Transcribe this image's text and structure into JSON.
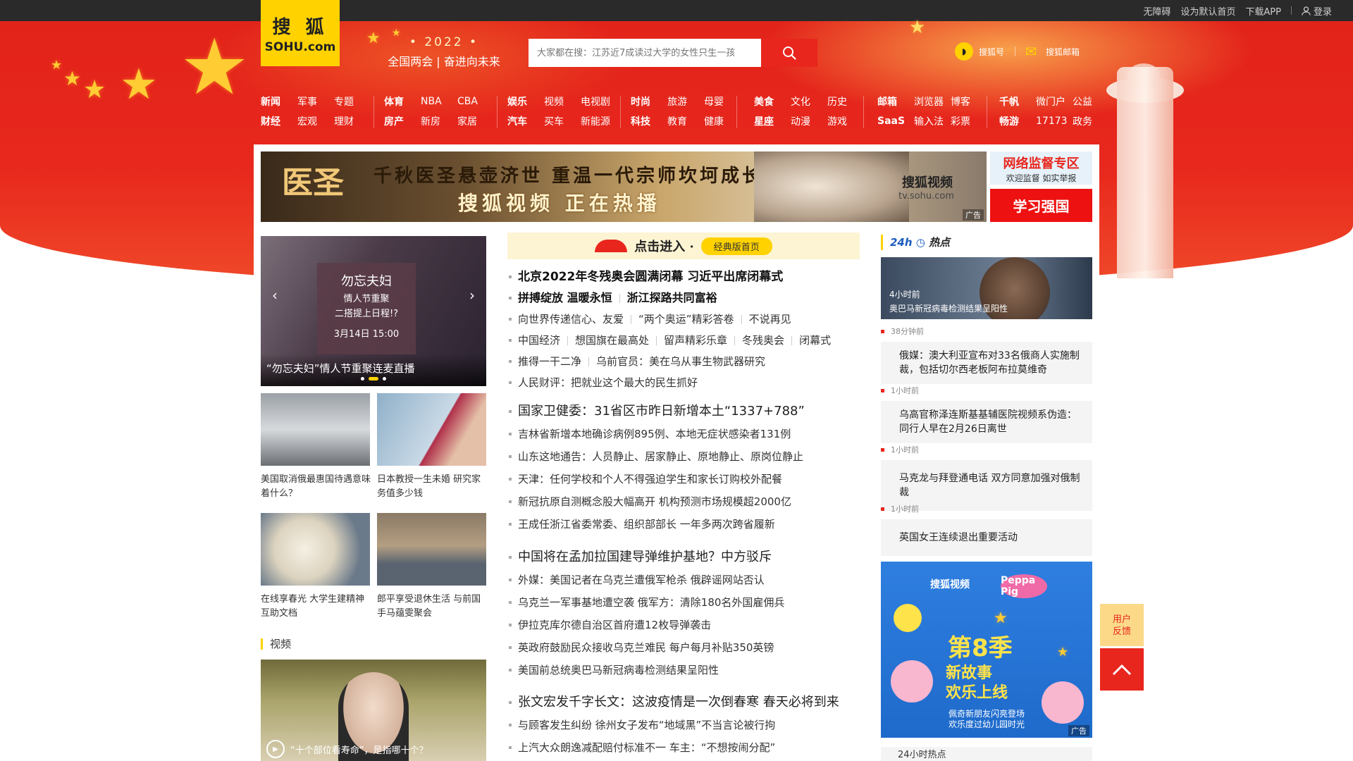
{
  "topbar": {
    "links": [
      "无障碍",
      "设为默认首页",
      "下载APP"
    ],
    "login": "登录"
  },
  "logo": {
    "text": "搜 狐",
    "sub": "SOHU.com"
  },
  "slogan": {
    "year": "• 2022 •",
    "line": "全国两会 | 奋进向未来"
  },
  "search": {
    "placeholder": "大家都在搜：江苏近7成读过大学的女性只生一孩"
  },
  "header_links": {
    "sohuhao": "搜狐号",
    "mail": "搜狐邮箱"
  },
  "nav": [
    {
      "row1": [
        "新闻",
        "军事",
        "专题"
      ],
      "row2": [
        "财经",
        "宏观",
        "理财"
      ]
    },
    {
      "row1": [
        "体育",
        "NBA",
        "CBA"
      ],
      "row2": [
        "房产",
        "新房",
        "家居"
      ]
    },
    {
      "row1": [
        "娱乐",
        "视频",
        "电视剧"
      ],
      "row2": [
        "汽车",
        "买车",
        "新能源"
      ]
    },
    {
      "row1": [
        "时尚",
        "旅游",
        "母婴"
      ],
      "row2": [
        "科技",
        "教育",
        "健康"
      ]
    },
    {
      "row1": [
        "美食",
        "文化",
        "历史"
      ],
      "row2": [
        "星座",
        "动漫",
        "游戏"
      ]
    },
    {
      "row1": [
        "邮箱",
        "浏览器",
        "博客"
      ],
      "row2": [
        "SaaS",
        "输入法",
        "彩票"
      ]
    },
    {
      "row1": [
        "千帆",
        "微门户",
        "公益"
      ],
      "row2": [
        "畅游",
        "17173",
        "政务"
      ]
    }
  ],
  "banner": {
    "seal": "医圣",
    "line1": "千秋医圣悬壶济世 重温一代宗师坎坷成长路",
    "line2": "搜狐视频 正在热播",
    "brand": "搜狐视频",
    "url": "tv.sohu.com",
    "ad": "广告"
  },
  "side_ads": {
    "title": "网络监督专区",
    "subtitle": "欢迎监督 如实举报",
    "xuexi": "学习强国"
  },
  "carousel": {
    "poster_title": "勿忘夫妇",
    "poster_sub1": "情人节重聚",
    "poster_sub2": "二搭提上日程!?",
    "poster_date": "3月14日 15:00",
    "caption": "“勿忘夫妇”情人节重聚连麦直播"
  },
  "thumbs": [
    {
      "caption": "美国取消俄最惠国待遇意味着什么？"
    },
    {
      "caption": "日本教授一生未婚 研究家务值多少钱"
    },
    {
      "caption": "在线享春光 大学生建精神互助文档"
    },
    {
      "caption": "郎平享受退休生活 与前国手马蕴雯聚会"
    }
  ],
  "video_section": {
    "title": "视频",
    "caption": "“十个部位看寿命”，是指哪十个？"
  },
  "classic": {
    "title": "点击进入 ·",
    "button": "经典版首页"
  },
  "news_group1": {
    "headline": "北京2022年冬残奥会圆满闭幕 习近平出席闭幕式",
    "sub": [
      "拼搏绽放 温暖永恒",
      "浙江探路共同富裕"
    ],
    "row3": [
      "向世界传递信心、友爱",
      "“两个奥运”精彩答卷",
      "不说再见"
    ],
    "row4": [
      "中国经济",
      "想国旗在最高处",
      "留声精彩乐章",
      "冬残奥会",
      "闭幕式"
    ],
    "row5": [
      "推得一干二净",
      "乌前官员：美在乌从事生物武器研究"
    ],
    "row6": "人民财评：把就业这个最大的民生抓好"
  },
  "news_group2": [
    "国家卫健委：31省区市昨日新增本土“1337+788”",
    "吉林省新增本地确诊病例895例、本地无症状感染者131例",
    "山东这地通告：人员静止、居家静止、原地静止、原岗位静止",
    "天津：任何学校和个人不得强迫学生和家长订购校外配餐",
    "新冠抗原自测概念股大幅高开 机构预测市场规模超2000亿",
    "王成任浙江省委常委、组织部部长 一年多两次跨省履新"
  ],
  "news_group3": [
    "中国将在孟加拉国建导弹维护基地？中方驳斥",
    "外媒：美国记者在乌克兰遭俄军枪杀 俄辟谣网站否认",
    "乌克兰一军事基地遭空袭 俄军方：清除180名外国雇佣兵",
    "伊拉克库尔德自治区首府遭12枚导弹袭击",
    "英政府鼓励民众接收乌克兰难民 每户每月补贴350英镑",
    "美国前总统奥巴马新冠病毒检测结果呈阳性"
  ],
  "news_group4": [
    "张文宏发千字长文：这波疫情是一次倒春寒 春天必将到来",
    "与顾客发生纠纷 徐州女子发布“地域黑”不当言论被行拘",
    "上汽大众朗逸减配赔付标准不一 车主：“不想按闹分配”"
  ],
  "hot": {
    "title_a": "24h",
    "title_b": "热点",
    "img_time": "4小时前",
    "img_caption": "奥巴马新冠病毒检测结果呈阳性",
    "items": [
      {
        "time": "38分钟前",
        "text": "俄媒：澳大利亚宣布对33名俄商人实施制裁，包括切尔西老板阿布拉莫维奇"
      },
      {
        "time": "1小时前",
        "text": "乌高官称泽连斯基基辅医院视频系伪造：同行人早在2月26日离世"
      },
      {
        "time": "1小时前",
        "text": "马克龙与拜登通电话 双方同意加强对俄制裁"
      },
      {
        "time": "1小时前",
        "text": "英国女王连续退出重要活动"
      }
    ]
  },
  "right_ad": {
    "brand": "搜狐视频",
    "pig": "Peppa Pig",
    "big": "第8季",
    "s1": "新故事",
    "s2": "欢乐上线",
    "s3": "佩奇新朋友闪亮登场",
    "s4": "欢乐度过幼儿园时光",
    "ad": "广告"
  },
  "more": "24小时热点",
  "feedback": {
    "l1": "用户",
    "l2": "反馈"
  }
}
